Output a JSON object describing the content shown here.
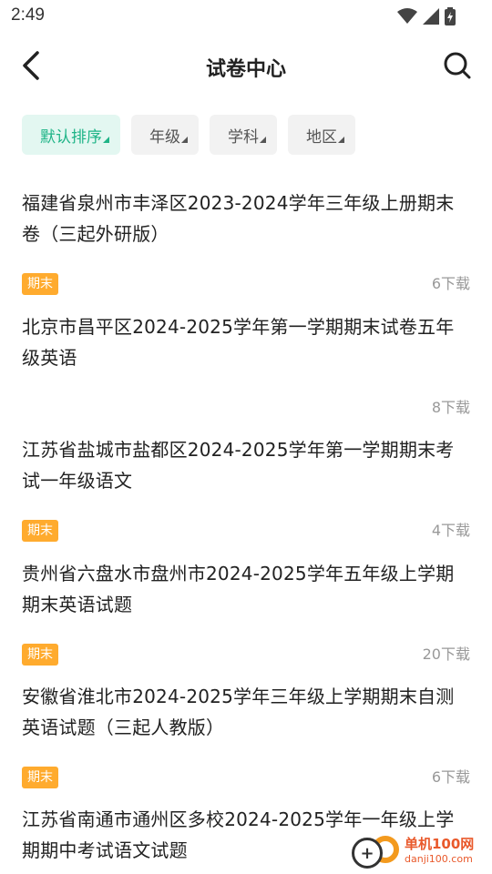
{
  "status_bar": {
    "time": "2:49",
    "icons": [
      "wifi-icon",
      "signal-icon",
      "battery-icon"
    ]
  },
  "header": {
    "title": "试卷中心",
    "back_icon": "chevron-left-icon",
    "search_icon": "search-icon"
  },
  "filters": [
    {
      "label": "默认排序",
      "active": true
    },
    {
      "label": "年级",
      "active": false
    },
    {
      "label": "学科",
      "active": false
    },
    {
      "label": "地区",
      "active": false
    }
  ],
  "papers": [
    {
      "title": "福建省泉州市丰泽区2023-2024学年三年级上册期末卷（三起外研版）",
      "tag": "期末",
      "downloads": "6下载"
    },
    {
      "title": "北京市昌平区2024-2025学年第一学期期末试卷五年级英语",
      "tag": "",
      "downloads": "8下载"
    },
    {
      "title": "江苏省盐城市盐都区2024-2025学年第一学期期末考试一年级语文",
      "tag": "期末",
      "downloads": "4下载"
    },
    {
      "title": "贵州省六盘水市盘州市2024-2025学年五年级上学期期末英语试题",
      "tag": "期末",
      "downloads": "20下载"
    },
    {
      "title": "安徽省淮北市2024-2025学年三年级上学期期末自测英语试题（三起人教版）",
      "tag": "期末",
      "downloads": "6下载"
    },
    {
      "title": "江苏省南通市通州区多校2024-2025学年一年级上学期期中考试语文试题",
      "tag": "",
      "downloads": ""
    }
  ],
  "watermark": {
    "name": "单机100网",
    "url": "danji100.com"
  },
  "colors": {
    "accent": "#1fb487",
    "accent_bg": "#e3f7f1",
    "tag_bg": "#ffab2e",
    "muted": "#999999"
  }
}
